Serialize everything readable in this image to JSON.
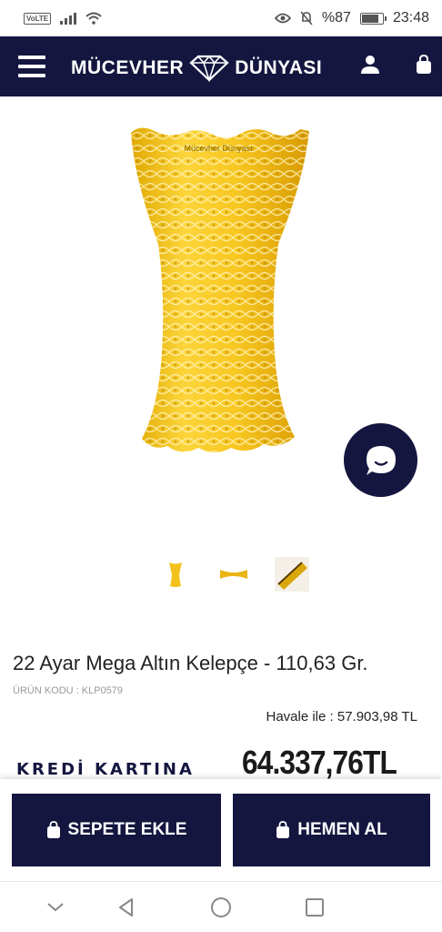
{
  "statusbar": {
    "network_badge": "VoLTE",
    "battery": "%87",
    "time": "23:48",
    "icons": [
      "signal-icon",
      "wifi-icon",
      "eye-icon",
      "bell-off-icon",
      "battery-icon"
    ]
  },
  "header": {
    "brand_left": "MÜCEVHER",
    "brand_right": "DÜNYASI",
    "icons": [
      "menu-icon",
      "diamond-logo-icon",
      "user-icon",
      "shopping-bag-icon"
    ]
  },
  "product": {
    "image_watermark": "Mücevher Dünyası",
    "title": "22 Ayar Mega Altın Kelepçe - 110,63 Gr.",
    "code": "ÜRÜN KODU : KLP0579",
    "havale_price": "Havale ile :  57.903,98 TL",
    "kredi_label": "KREDİ KARTINA",
    "price": "64.337,76TL",
    "thumbnails": [
      "thumb-front",
      "thumb-side",
      "thumb-detail"
    ]
  },
  "actions": {
    "add_to_cart": "SEPETE EKLE",
    "buy_now": "HEMEN AL"
  },
  "colors": {
    "brand_navy": "#14163f",
    "gold": "#f3c21a"
  }
}
